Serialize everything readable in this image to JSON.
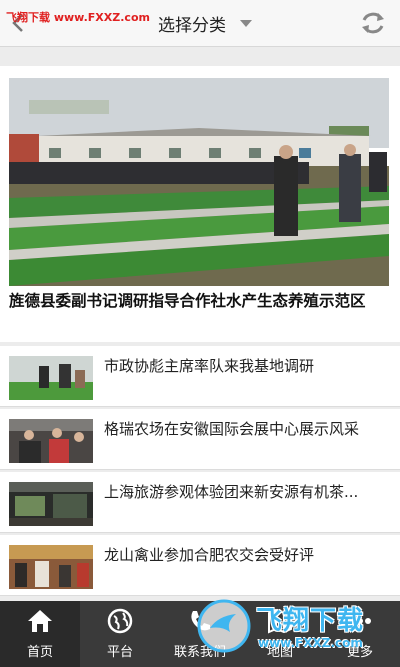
{
  "watermark_top": "飞翔下载 www.FXXZ.com",
  "header": {
    "category_label": "选择分类"
  },
  "featured": {
    "title": "旌德县委副书记调研指导合作社水产生态养殖示范区"
  },
  "news": [
    {
      "title": "市政协彪主席率队来我基地调研"
    },
    {
      "title": "格瑞农场在安徽国际会展中心展示风采"
    },
    {
      "title": "上海旅游参观体验团来新安源有机茶..."
    },
    {
      "title": "龙山禽业参加合肥农交会受好评"
    }
  ],
  "bottom_nav": [
    {
      "label": "首页",
      "icon": "home-icon"
    },
    {
      "label": "平台",
      "icon": "globe-icon"
    },
    {
      "label": "联系我们",
      "icon": "phone-icon"
    },
    {
      "label": "地图",
      "icon": "map-icon"
    },
    {
      "label": "更多",
      "icon": "more-icon"
    }
  ],
  "watermark_bottom": {
    "brand": "飞翔下载",
    "url": "www.FXXZ.com"
  },
  "colors": {
    "header_bg": "#f7f7f7",
    "nav_bg": "#3a3a3a",
    "watermark_red": "#e02020",
    "watermark_blue": "#3fb6f0"
  }
}
